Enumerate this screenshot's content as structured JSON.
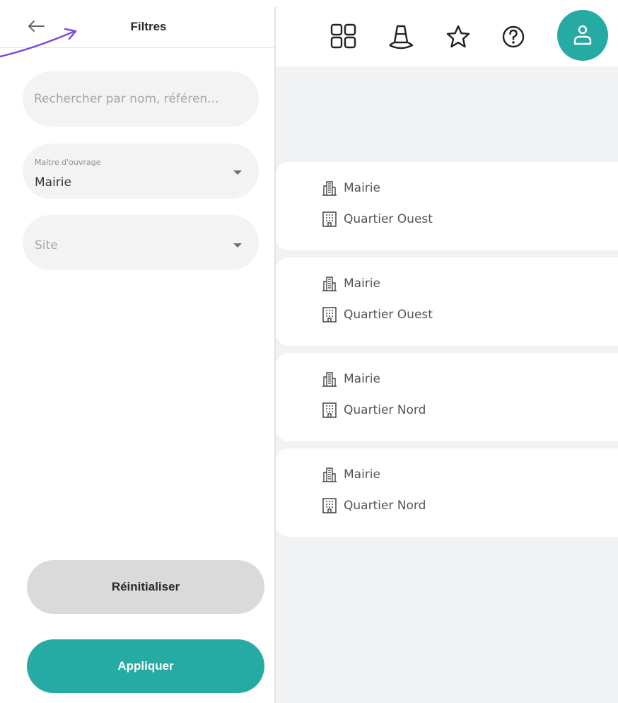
{
  "header": {
    "title": "Filtres"
  },
  "filters": {
    "search": {
      "placeholder": "Rechercher par nom, référen..."
    },
    "owner": {
      "label": "Maitre d'ouvrage",
      "value": "Mairie"
    },
    "site": {
      "placeholder": "Site"
    }
  },
  "buttons": {
    "reset": "Réinitialiser",
    "apply": "Appliquer"
  },
  "topbar": {
    "icons": [
      "grid-icon",
      "wizard-hat-icon",
      "star-icon",
      "help-icon",
      "user-icon"
    ]
  },
  "cards": [
    {
      "owner": "Mairie",
      "site": "Quartier Ouest"
    },
    {
      "owner": "Mairie",
      "site": "Quartier Ouest"
    },
    {
      "owner": "Mairie",
      "site": "Quartier Nord"
    },
    {
      "owner": "Mairie",
      "site": "Quartier Nord"
    }
  ],
  "colors": {
    "accent": "#26aaa4",
    "reset_button": "#dadada",
    "field_background": "#f3f3f3",
    "content_background": "#f0f2f4",
    "annotation_arrow": "#7b4bdc"
  }
}
